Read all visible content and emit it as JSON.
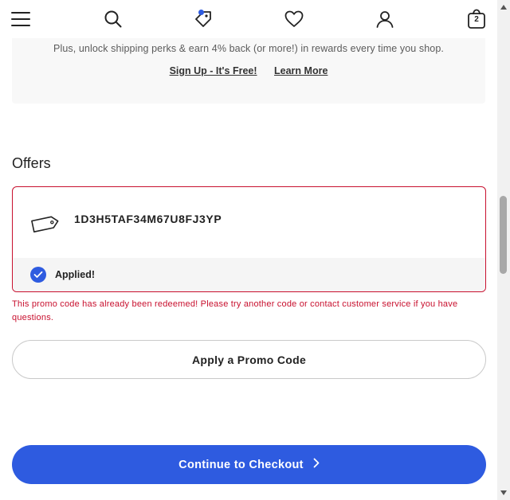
{
  "nav": {
    "menu_icon": "hamburger-menu-icon",
    "search_icon": "search-icon",
    "offers_icon": "tag-offers-icon",
    "wishlist_icon": "heart-icon",
    "account_icon": "user-icon",
    "bag_icon": "shopping-bag-icon",
    "bag_count": "2"
  },
  "rewards": {
    "perks_text": "Plus, unlock shipping perks & earn 4% back (or more!) in rewards every time you shop.",
    "signup_link": "Sign Up - It's Free!",
    "learn_more_link": "Learn More"
  },
  "offers": {
    "title": "Offers",
    "code": "1D3H5TAF34M67U8FJ3YP",
    "status": "Applied!",
    "error": "This promo code has already been redeemed! Please try another code or contact customer service if you have questions."
  },
  "actions": {
    "apply_promo": "Apply a Promo Code",
    "checkout": "Continue to Checkout"
  },
  "colors": {
    "accent": "#2e5be0",
    "error": "#c8102e"
  }
}
